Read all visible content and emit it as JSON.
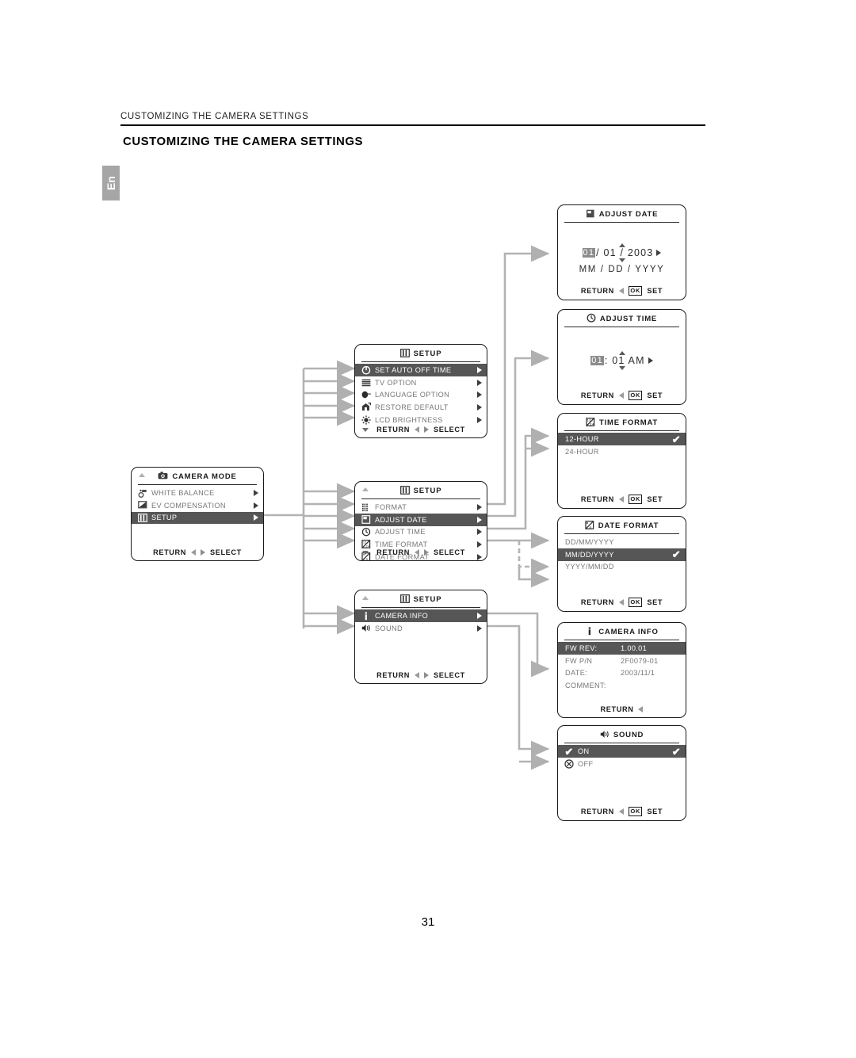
{
  "document": {
    "running_head": "CUSTOMIZING THE CAMERA SETTINGS",
    "page_title": "CUSTOMIZING THE CAMERA SETTINGS",
    "language_tab": "En",
    "page_number": "31"
  },
  "labels": {
    "return": "RETURN",
    "select": "SELECT",
    "set": "SET",
    "ok": "OK"
  },
  "panels": {
    "camera_mode": {
      "title": "CAMERA MODE",
      "title_icon": "camera-icon",
      "items": [
        {
          "label": "WHITE BALANCE",
          "icon": "white-balance-icon",
          "selected": false,
          "arrow": true
        },
        {
          "label": "EV COMPENSATION",
          "icon": "ev-compensation-icon",
          "selected": false,
          "arrow": true
        },
        {
          "label": "SETUP",
          "icon": "setup-icon",
          "selected": true,
          "arrow": true
        }
      ],
      "footer_left": "RETURN",
      "footer_right": "SELECT"
    },
    "setup_page1": {
      "title": "SETUP",
      "title_icon": "setup-icon",
      "items": [
        {
          "label": "SET AUTO OFF TIME",
          "icon": "power-icon",
          "selected": true,
          "arrow": true
        },
        {
          "label": "TV OPTION",
          "icon": "tv-option-icon",
          "selected": false,
          "arrow": true
        },
        {
          "label": "LANGUAGE OPTION",
          "icon": "language-icon",
          "selected": false,
          "arrow": true
        },
        {
          "label": "RESTORE DEFAULT",
          "icon": "restore-default-icon",
          "selected": false,
          "arrow": true
        },
        {
          "label": "LCD BRIGHTNESS",
          "icon": "brightness-icon",
          "selected": false,
          "arrow": true
        }
      ],
      "footer_left": "RETURN",
      "footer_right": "SELECT"
    },
    "setup_page2": {
      "title": "SETUP",
      "title_icon": "setup-icon",
      "items": [
        {
          "label": "FORMAT",
          "icon": "format-icon",
          "selected": false,
          "arrow": true
        },
        {
          "label": "ADJUST DATE",
          "icon": "calendar-icon",
          "selected": true,
          "arrow": true
        },
        {
          "label": "ADJUST TIME",
          "icon": "clock-icon",
          "selected": false,
          "arrow": true
        },
        {
          "label": "TIME FORMAT",
          "icon": "time-format-icon",
          "selected": false,
          "arrow": true
        },
        {
          "label": "DATE FORMAT",
          "icon": "date-format-icon",
          "selected": false,
          "arrow": true
        }
      ],
      "footer_left": "RETURN",
      "footer_right": "SELECT"
    },
    "setup_page3": {
      "title": "SETUP",
      "title_icon": "setup-icon",
      "items": [
        {
          "label": "CAMERA INFO",
          "icon": "info-icon",
          "selected": true,
          "arrow": true
        },
        {
          "label": "SOUND",
          "icon": "sound-icon",
          "selected": false,
          "arrow": true
        }
      ],
      "footer_left": "RETURN",
      "footer_right": "SELECT"
    },
    "adjust_date": {
      "title": "ADJUST DATE",
      "title_icon": "calendar-icon",
      "value_highlight": "01",
      "value_rest": "/ 01 / 2003",
      "format_line": "MM / DD / YYYY",
      "footer_left": "RETURN",
      "footer_right": "SET"
    },
    "adjust_time": {
      "title": "ADJUST TIME",
      "title_icon": "clock-icon",
      "value_highlight": "01",
      "value_rest": ": 01 AM",
      "format_line": "",
      "footer_left": "RETURN",
      "footer_right": "SET"
    },
    "time_format": {
      "title": "TIME FORMAT",
      "title_icon": "time-format-icon",
      "items": [
        {
          "label": "12-HOUR",
          "selected": true,
          "check": true
        },
        {
          "label": "24-HOUR",
          "selected": false,
          "check": false
        }
      ],
      "footer_left": "RETURN",
      "footer_right": "SET"
    },
    "date_format": {
      "title": "DATE FORMAT",
      "title_icon": "date-format-icon",
      "items": [
        {
          "label": "DD/MM/YYYY",
          "selected": false,
          "check": false
        },
        {
          "label": "MM/DD/YYYY",
          "selected": true,
          "check": true
        },
        {
          "label": "YYYY/MM/DD",
          "selected": false,
          "check": false
        }
      ],
      "footer_left": "RETURN",
      "footer_right": "SET"
    },
    "camera_info": {
      "title": "CAMERA INFO",
      "title_icon": "info-icon",
      "items": [
        {
          "label": "FW REV:",
          "value": "1.00.01",
          "selected": true
        },
        {
          "label": "FW P/N",
          "value": "2F0079-01",
          "selected": false
        },
        {
          "label": "DATE:",
          "value": "2003/11/1",
          "selected": false
        },
        {
          "label": "COMMENT:",
          "value": "",
          "selected": false
        }
      ],
      "footer_left": "RETURN",
      "footer_right": ""
    },
    "sound": {
      "title": "SOUND",
      "title_icon": "sound-icon",
      "items": [
        {
          "label": "ON",
          "icon": "check-icon",
          "selected": true,
          "check": true
        },
        {
          "label": "OFF",
          "icon": "x-circle-icon",
          "selected": false,
          "check": false
        }
      ],
      "footer_left": "RETURN",
      "footer_right": "SET"
    }
  },
  "colors": {
    "selected_row_bg": "#565656",
    "panel_border": "#1a1a1a",
    "wire": "#b3b3b3",
    "tab_bg": "#a6a6a6",
    "muted_text": "#777777"
  }
}
